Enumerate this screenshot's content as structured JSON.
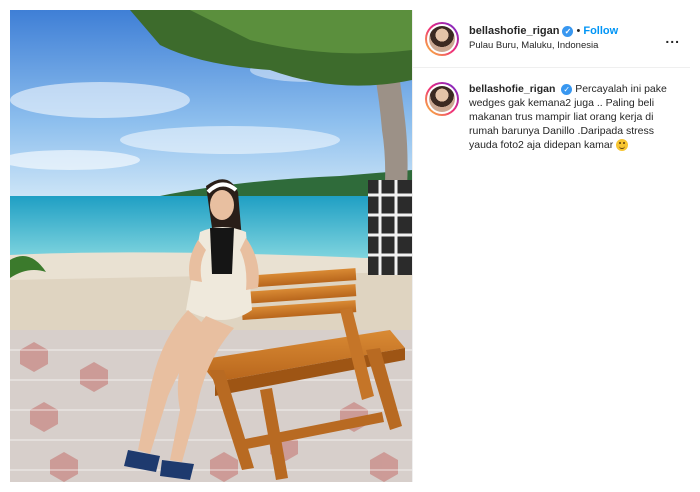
{
  "post": {
    "username": "bellashofie_rigan",
    "verified_icon": "verified-badge-icon",
    "separator": "•",
    "follow_label": "Follow",
    "location": "Pulau Buru, Maluku, Indonesia",
    "more_label": "...",
    "caption": {
      "username": "bellashofie_rigan",
      "text": "Percayalah ini pake wedges gak kemana2 juga .. Paling beli makanan trus mampir liat orang kerja di rumah barunya Danillo .Daripada stress yauda foto2 aja didepan kamar",
      "emoji": "grinning-face-emoji"
    }
  },
  "colors": {
    "follow": "#0095f6",
    "verified": "#3897f0",
    "border": "#efefef"
  }
}
